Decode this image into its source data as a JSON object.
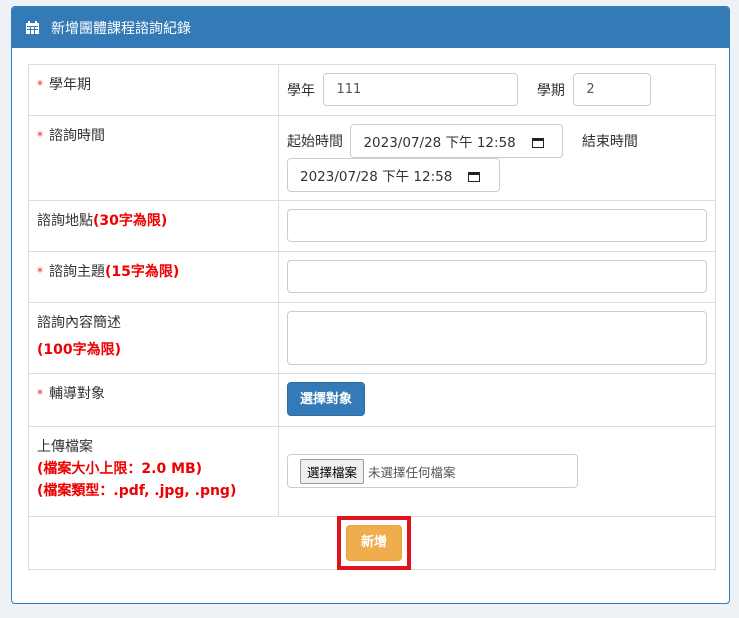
{
  "header": {
    "title": "新增團體課程諮詢紀錄",
    "icon": "calendar-icon"
  },
  "form": {
    "term": {
      "label": "學年期",
      "year_label": "學年",
      "year_value": "111",
      "semester_label": "學期",
      "semester_value": "2"
    },
    "time": {
      "label": "諮詢時間",
      "start_label": "起始時間",
      "start_value": "2023/07/28 下午 12:58",
      "end_label": "結束時間",
      "end_value": "2023/07/28 下午 12:58"
    },
    "location": {
      "label": "諮詢地點",
      "limit": "(30字為限)",
      "value": ""
    },
    "topic": {
      "label": "諮詢主題",
      "limit": "(15字為限)",
      "value": ""
    },
    "content": {
      "label": "諮詢內容簡述",
      "limit": "(100字為限)",
      "value": ""
    },
    "target": {
      "label": "輔導對象",
      "button": "選擇對象"
    },
    "upload": {
      "label": "上傳檔案",
      "size_limit": "(檔案大小上限：2.0 MB)",
      "type_limit": "(檔案類型：.pdf, .jpg, .png)",
      "choose_button": "選擇檔案",
      "status": "未選擇任何檔案"
    },
    "required_mark": "*",
    "submit": "新增"
  },
  "colors": {
    "header_bg": "#337ab7",
    "required": "#e12727",
    "submit_bg": "#f0ad4e",
    "highlight": "#e0141c"
  }
}
